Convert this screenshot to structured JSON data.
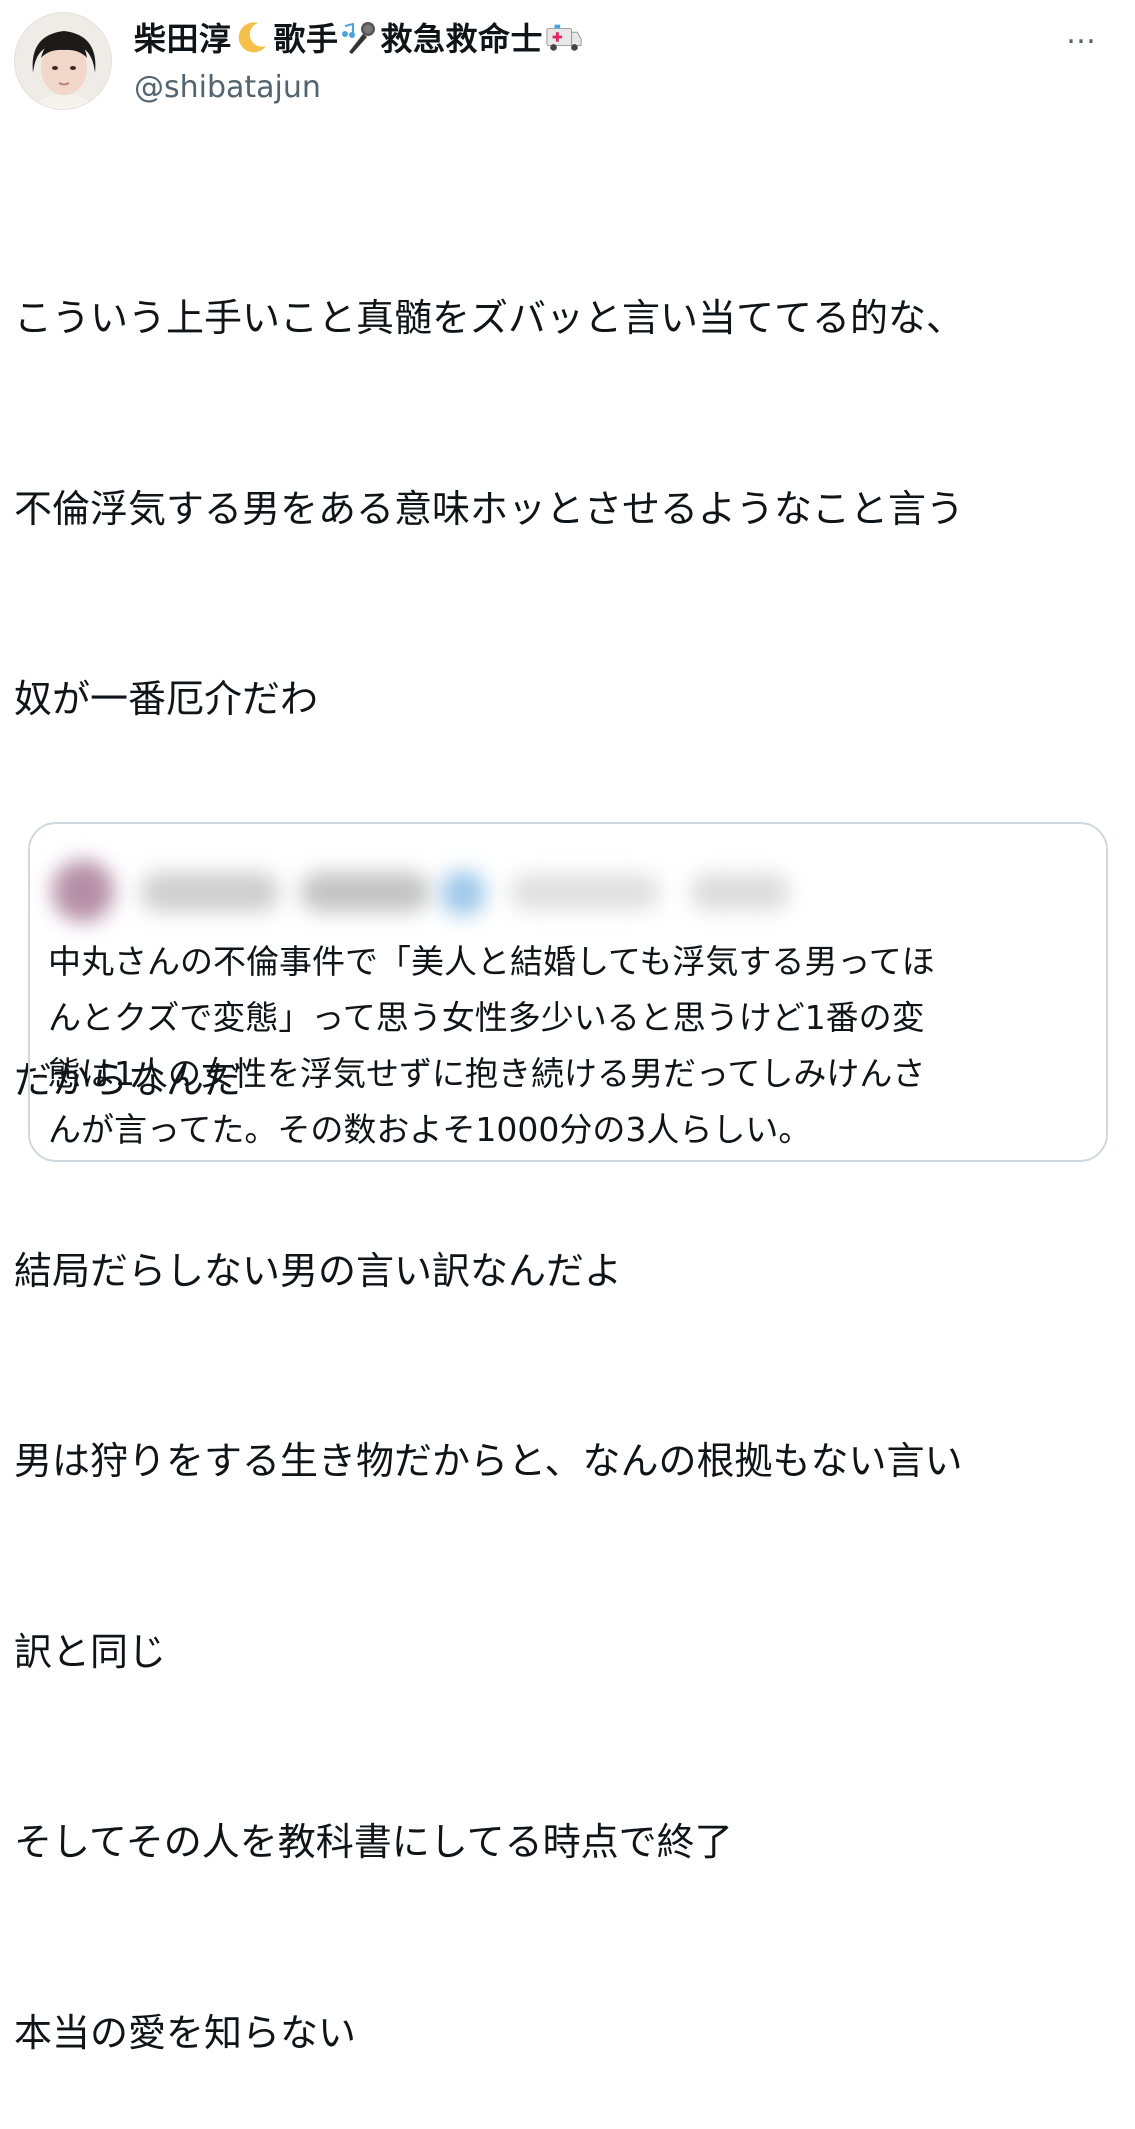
{
  "author": {
    "display_name": "柴田淳",
    "name_part2": "歌手",
    "name_part3": "救急救命士",
    "handle": "@shibatajun",
    "emojis": [
      "crescent-moon",
      "music-notes-microphone",
      "ambulance"
    ]
  },
  "menu": {
    "more_label": "…"
  },
  "tweet": {
    "lines": [
      "こういう上手いこと真髄をズバッと言い当ててる的な、",
      "不倫浮気する男をある意味ホッとさせるようなこと言う",
      "奴が一番厄介だわ",
      "",
      "だからなんだ",
      "結局だらしない男の言い訳なんだよ",
      "男は狩りをする生き物だからと、なんの根拠もない言い",
      "訳と同じ",
      "そしてその人を教科書にしてる時点で終了",
      "本当の愛を知らない"
    ]
  },
  "quoted_tweet": {
    "author_blurred": true,
    "lines": [
      "中丸さんの不倫事件で「美人と結婚しても浮気する男ってほ",
      "んとクズで変態」って思う女性多少いると思うけど1番の変",
      "態は1人の女性を浮気せずに抱き続ける男だってしみけんさ",
      "んが言ってた。その数およそ1000分の3人らしい。"
    ]
  },
  "colors": {
    "text": "#0f1419",
    "secondary": "#536471",
    "border": "#cfd9de"
  }
}
